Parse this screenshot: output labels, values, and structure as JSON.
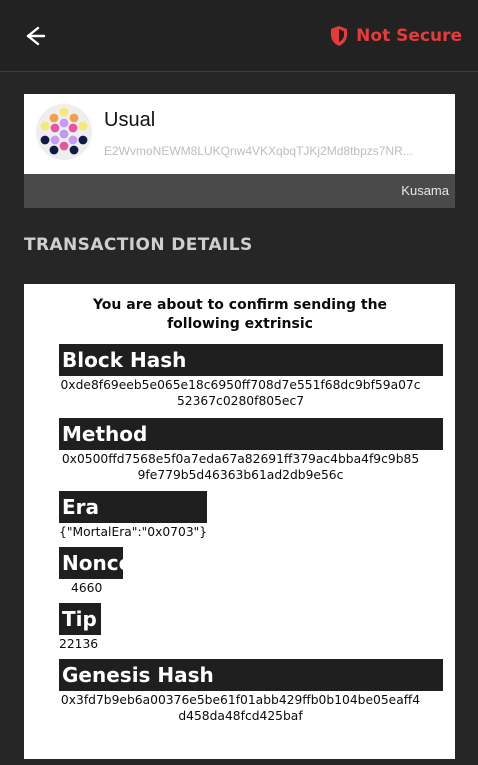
{
  "header": {
    "back_icon": "left-arrow-icon",
    "security_icon": "shield-icon",
    "security_status": "Not Secure",
    "security_color": "#e53b3b"
  },
  "account": {
    "name": "Usual",
    "address": "E2WvmoNEWM8LUKQnw4VKXqbqTJKj2Md8tbpzs7NR...",
    "network": "Kusama",
    "identicon": "account-identicon"
  },
  "section": {
    "title": "TRANSACTION DETAILS"
  },
  "transaction": {
    "intro": "You are about to confirm sending the following extrinsic",
    "fields": {
      "block_hash": {
        "label": "Block Hash",
        "value": "0xde8f69eeb5e065e18c6950ff708d7e551f68dc9bf59a07c52367c0280f805ec7"
      },
      "method": {
        "label": "Method",
        "value": "0x0500ffd7568e5f0a7eda67a82691ff379ac4bba4f9c9b859fe779b5d46363b61ad2db9e56c"
      },
      "era": {
        "label": "Era",
        "value": "{\"MortalEra\":\"0x0703\"}"
      },
      "nonce": {
        "label": "Nonce",
        "value": "4660"
      },
      "tip": {
        "label": "Tip",
        "value": "22136"
      },
      "genesis_hash": {
        "label": "Genesis Hash",
        "value": "0x3fd7b9eb6a00376e5be61f01abb429ffb0b104be05eaff4d458da48fcd425baf"
      }
    }
  },
  "colors": {
    "background": "#262626",
    "header": "#222222",
    "card": "#ffffff",
    "field_label": "#1f1f1f",
    "network_bar": "#4a4a4a",
    "security": "#e53b3b"
  }
}
